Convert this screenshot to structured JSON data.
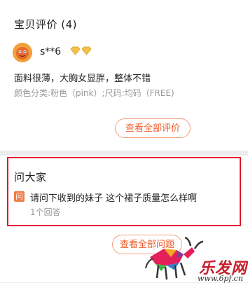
{
  "reviews": {
    "title": "宝贝评价 (4)",
    "review": {
      "username": "s**6",
      "avatar_icon": "cartoon-face-avatar",
      "badge_icon": "diamond-level-icon",
      "badge_count": 2,
      "text": "面料很薄，大胸女显胖，整体不错",
      "spec": "颜色分类:粉色（pink）;尺码:均码（FREE)"
    },
    "view_all_label": "查看全部评价"
  },
  "qa": {
    "title": "问大家",
    "badge": "问",
    "question": "请问下收到的妹子 这个裙子质量怎么样啊",
    "answer_count": "1个回答",
    "view_all_label": "查看全部问题"
  },
  "watermark": {
    "name": "乐发网",
    "url": "www.6pf.cn"
  },
  "colors": {
    "accent": "#f05b27",
    "highlight_border": "#e2182f",
    "muted_text": "#999999",
    "badge_bg": "#f07a45"
  }
}
